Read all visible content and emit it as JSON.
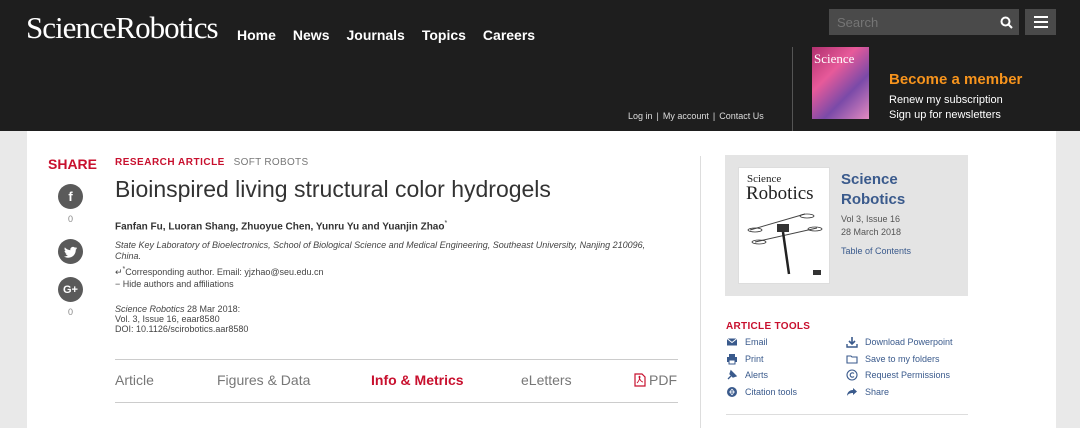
{
  "header": {
    "logo": "ScienceRobotics",
    "nav": [
      "Home",
      "News",
      "Journals",
      "Topics",
      "Careers"
    ],
    "search_placeholder": "Search",
    "links": [
      "Log in",
      "|",
      "My account",
      "|",
      "Contact Us"
    ],
    "cover_title": "Science",
    "member_title": "Become a member",
    "member_lines": [
      "Renew my subscription",
      "Sign up for newsletters"
    ]
  },
  "share": {
    "label": "SHARE",
    "items": [
      {
        "icon": "facebook-icon",
        "glyph": "f",
        "count": "0"
      },
      {
        "icon": "twitter-icon",
        "glyph": "t",
        "count": ""
      },
      {
        "icon": "google-plus-icon",
        "glyph": "G+",
        "count": "0"
      }
    ]
  },
  "article": {
    "type": "RESEARCH ARTICLE",
    "subject": "SOFT ROBOTS",
    "title": "Bioinspired living structural color hydrogels",
    "authors": "Fanfan Fu, Luoran Shang, Zhuoyue Chen, Yunru Yu and Yuanjin Zhao",
    "author_mark": "*",
    "affiliation": "State Key Laboratory of Bioelectronics, School of Biological Science and Medical Engineering, Southeast University, Nanjing 210096, China.",
    "corresponding": "Corresponding author. Email: yjzhao@seu.edu.cn",
    "corresponding_mark": "*",
    "hide": "Hide authors and affiliations",
    "citation_journal": "Science Robotics",
    "citation_date": " 28 Mar 2018:",
    "citation_vol": "Vol. 3, Issue 16, eaar8580",
    "citation_doi": "DOI: 10.1126/scirobotics.aar8580"
  },
  "tabs": [
    {
      "label": "Article",
      "active": false
    },
    {
      "label": "Figures & Data",
      "active": false
    },
    {
      "label": "Info & Metrics",
      "active": true
    },
    {
      "label": "eLetters",
      "active": false
    },
    {
      "label": "PDF",
      "active": false
    }
  ],
  "journal": {
    "cover_science": "Science",
    "cover_robotics": "Robotics",
    "name_line1": "Science",
    "name_line2": "Robotics",
    "issue": "Vol 3, Issue 16",
    "date": "28 March 2018",
    "toc": "Table of Contents"
  },
  "tools": {
    "title": "ARTICLE TOOLS",
    "left": [
      {
        "label": "Email",
        "icon": "email-icon"
      },
      {
        "label": "Print",
        "icon": "print-icon"
      },
      {
        "label": "Alerts",
        "icon": "alerts-icon"
      },
      {
        "label": "Citation tools",
        "icon": "citation-icon"
      }
    ],
    "right": [
      {
        "label": "Download Powerpoint",
        "icon": "download-icon"
      },
      {
        "label": "Save to my folders",
        "icon": "folder-icon"
      },
      {
        "label": "Request Permissions",
        "icon": "copyright-icon"
      },
      {
        "label": "Share",
        "icon": "share-icon"
      }
    ]
  },
  "colors": {
    "accent": "#c8102e",
    "link": "#3a5a8c",
    "member": "#f7941d",
    "header_bg": "#1e1e1e"
  }
}
